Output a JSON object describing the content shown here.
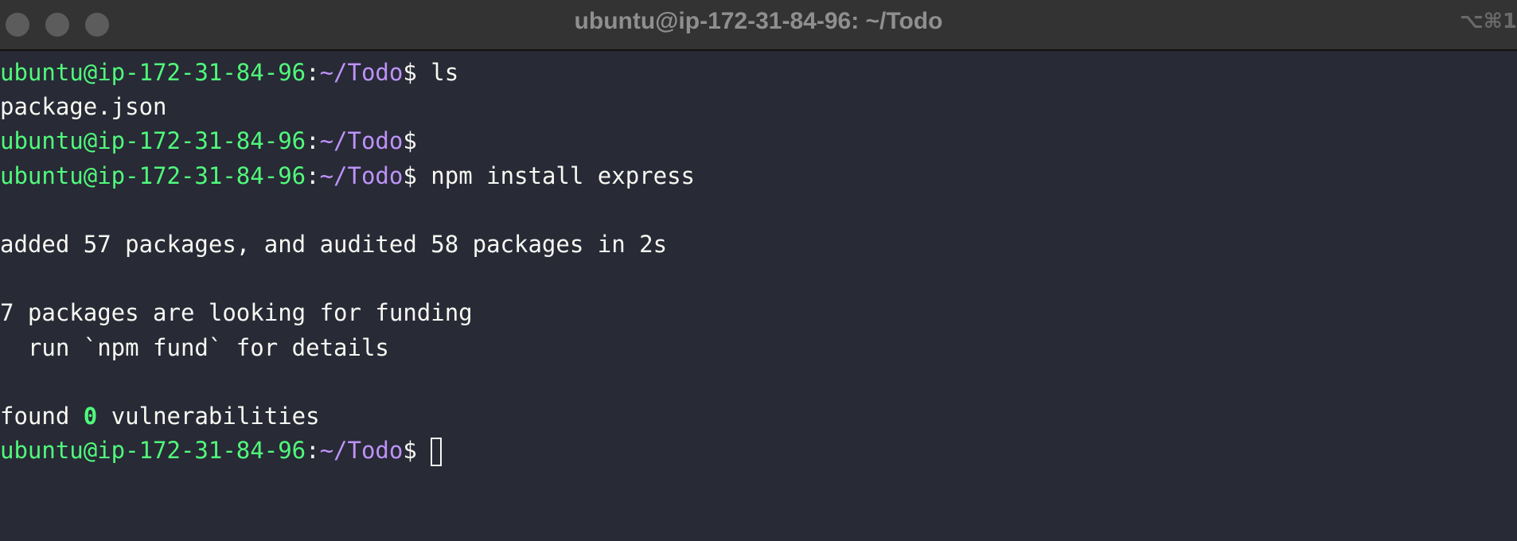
{
  "window": {
    "title": "ubuntu@ip-172-31-84-96: ~/Todo",
    "shortcut": "⌥⌘1"
  },
  "terminal": {
    "prompt_user": "ubuntu@ip-172-31-84-96",
    "prompt_sep": ":",
    "prompt_path": "~/Todo",
    "prompt_symbol": "$",
    "lines": {
      "l1_cmd": " ls",
      "l2_out": "package.json",
      "l4_cmd": " npm install express",
      "l5_out": "",
      "l6_out": "added 57 packages, and audited 58 packages in 2s",
      "l7_out": "",
      "l8_out": "7 packages are looking for funding",
      "l9_out": "  run `npm fund` for details",
      "l10_out": "",
      "l11_pre": "found ",
      "l11_num": "0",
      "l11_post": " vulnerabilities",
      "l12_cmd": " "
    }
  },
  "colors": {
    "background": "#282a36",
    "prompt_user": "#50fa7b",
    "prompt_path": "#bd93f9",
    "text": "#f8f8f2",
    "titlebar": "#333333"
  }
}
